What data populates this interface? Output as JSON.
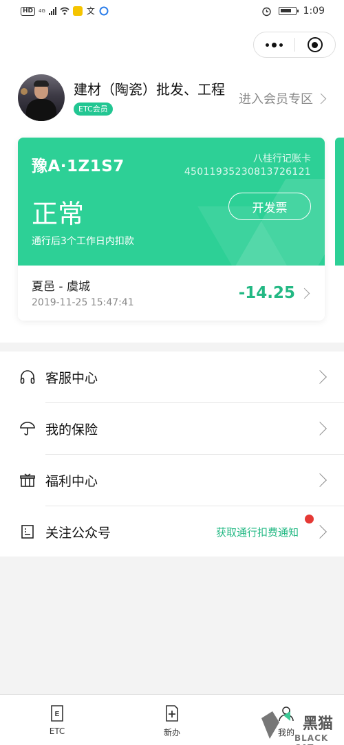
{
  "status_bar": {
    "hd": "HD",
    "network": "4G",
    "time": "1:09"
  },
  "header": {
    "more_icon": "more-dots-icon",
    "close_icon": "mini-program-close-icon"
  },
  "profile": {
    "name": "建材（陶瓷）批发、工程",
    "badge": "ETC会员",
    "member_link": "进入会员专区"
  },
  "card": {
    "plate": "豫A·1Z1S7",
    "card_type": "八桂行记账卡",
    "card_number": "4501193523081372612 1",
    "status": "正常",
    "invoice_button": "开发票",
    "deduct_note": "通行后3个工作日内扣款",
    "trip": {
      "route": "夏邑 - 虞城",
      "time": "2019-11-25 15:47:41",
      "amount": "-14.25"
    }
  },
  "menu": [
    {
      "icon": "headset-icon",
      "label": "客服中心"
    },
    {
      "icon": "umbrella-icon",
      "label": "我的保险"
    },
    {
      "icon": "gift-icon",
      "label": "福利中心"
    },
    {
      "icon": "document-icon",
      "label": "关注公众号",
      "extra": "获取通行扣费通知"
    }
  ],
  "tabbar": [
    {
      "icon": "etc-tab-icon",
      "label": "ETC"
    },
    {
      "icon": "add-doc-tab-icon",
      "label": "新办"
    },
    {
      "icon": "my-tab-icon",
      "label": "我的"
    }
  ],
  "watermark": {
    "text": "黑猫",
    "sub": "BLACK CAT"
  },
  "colors": {
    "brand_green": "#2dd096",
    "amount_green": "#22b883",
    "badge_green": "#22c692",
    "red_dot": "#e53935"
  }
}
